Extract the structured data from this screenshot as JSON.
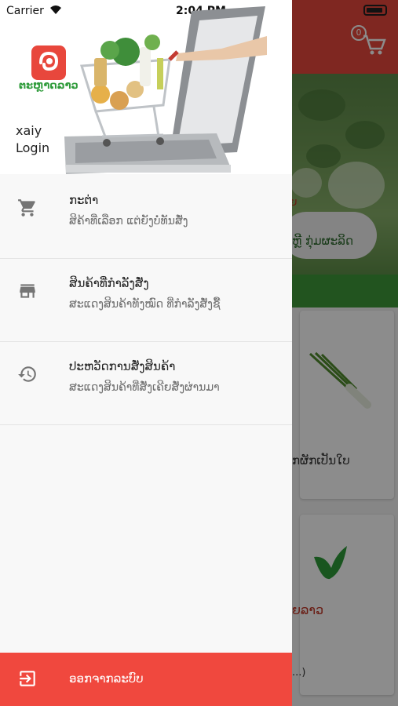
{
  "status_bar": {
    "carrier": "Carrier",
    "time": "2:04 PM"
  },
  "background": {
    "cart_count": "0",
    "banner_ribbon": "ອຍ",
    "banner_oval_text": "ຫຼີ ກຸ່ມຜະລິດ",
    "card1_text": "ກຜັກເປັນໃບ",
    "card2_text": "ຍລາວ",
    "card2_dots": "...)"
  },
  "drawer": {
    "logo_text": "ຕະຫຼາດລາວ",
    "user_name": "xaiy",
    "login_label": "Login",
    "menu": [
      {
        "icon": "cart-icon",
        "title": "ກະຕ່າ",
        "subtitle": "ສິຄ້າທີ່ເລືອກ ແຕ່ຍັງບໍ່ທັນສັ່ງ"
      },
      {
        "icon": "store-icon",
        "title": "ສິນຄ້າທີ່ກຳລັງສັ່ງ",
        "subtitle": "ສະແດງສິນຄ້າທັງໝົດ ທີ່ກຳລັງສັ່ງຊື້"
      },
      {
        "icon": "history-icon",
        "title": "ປະຫວັດການສັ່ງສິນຄ້າ",
        "subtitle": "ສະແດງສິນຄ້າທີ່ສັ່ງເຄີຍສັ່ງຜ່ານມາ"
      }
    ],
    "logout_label": "ອອກຈາກລະບົບ"
  },
  "colors": {
    "accent_red": "#f0483e",
    "header_red": "#e8473c",
    "brand_green": "#2e9b3a",
    "icon_gray": "#757575"
  }
}
